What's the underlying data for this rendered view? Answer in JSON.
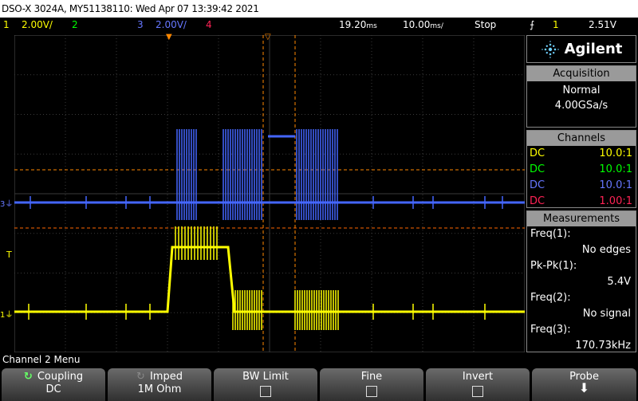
{
  "title": "DSO-X 3024A, MY51138110: Wed Apr 07 13:39:42 2021",
  "status": {
    "ch1_num": "1",
    "ch1_scale": "2.00V/",
    "ch2_num": "2",
    "ch3_num": "3",
    "ch3_scale": "2.00V/",
    "ch4_num": "4",
    "delay": "19.20",
    "timebase": "10.00",
    "run_state": "Stop",
    "trig_icon": "trigger-edge-icon",
    "trig_source": "1",
    "trig_level": "2.51V"
  },
  "brand": "Agilent",
  "acquisition": {
    "header": "Acquisition",
    "mode": "Normal",
    "rate": "4.00GSa/s"
  },
  "channels": {
    "header": "Channels",
    "rows": [
      {
        "coupling": "DC",
        "probe": "10.0:1",
        "color": "#ffff00"
      },
      {
        "coupling": "DC",
        "probe": "10.0:1",
        "color": "#00ff00"
      },
      {
        "coupling": "DC",
        "probe": "10.0:1",
        "color": "#6677ff"
      },
      {
        "coupling": "DC",
        "probe": "1.00:1",
        "color": "#ff2255"
      }
    ]
  },
  "measurements": {
    "header": "Measurements",
    "items": [
      {
        "label": "Freq(1):",
        "value": "No edges"
      },
      {
        "label": "Pk-Pk(1):",
        "value": "5.4V"
      },
      {
        "label": "Freq(2):",
        "value": "No signal"
      },
      {
        "label": "Freq(3):",
        "value": "170.73kHz"
      }
    ]
  },
  "markers": {
    "ch3": "3",
    "ch1": "1",
    "trig": "T"
  },
  "menu_title": "Channel 2 Menu",
  "softkeys": [
    {
      "label": "Coupling",
      "value": "DC"
    },
    {
      "label": "Imped",
      "value": "1M Ohm"
    },
    {
      "label": "BW Limit",
      "value": ""
    },
    {
      "label": "Fine",
      "value": ""
    },
    {
      "label": "Invert",
      "value": ""
    },
    {
      "label": "Probe",
      "value": ""
    }
  ],
  "colors": {
    "ch1": "#ffff00",
    "ch2": "#00ff00",
    "ch3": "#4466ff",
    "ch4": "#ff2255",
    "cursor": "#ff8800"
  }
}
